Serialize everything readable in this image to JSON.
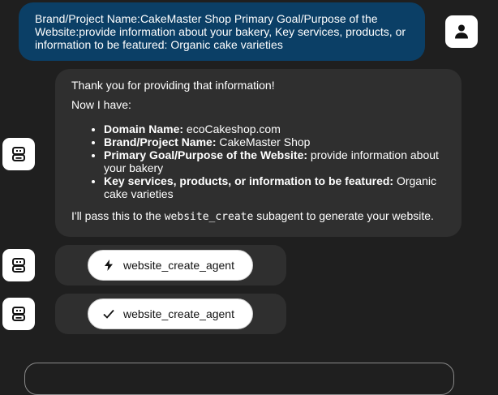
{
  "user_message": {
    "text": "Brand/Project Name:CakeMaster Shop Primary Goal/Purpose of the Website:provide information about your bakery, Key services, products, or information to be featured: Organic cake varieties"
  },
  "assistant_message": {
    "intro": "Thank you for providing that information!",
    "now_i_have": "Now I have:",
    "items": [
      {
        "label": "Domain Name:",
        "value": " ecoCakeshop.com"
      },
      {
        "label": "Brand/Project Name:",
        "value": " CakeMaster Shop"
      },
      {
        "label": "Primary Goal/Purpose of the Website:",
        "value": " provide information about your bakery"
      },
      {
        "label": "Key services, products, or information to be featured:",
        "value": " Organic cake varieties"
      }
    ],
    "outro_before": "I'll pass this to the ",
    "outro_code": "website_create",
    "outro_after": " subagent to generate your website."
  },
  "tool_calls": [
    {
      "label": "website_create_agent",
      "status": "running",
      "icon": "lightning-icon"
    },
    {
      "label": "website_create_agent",
      "status": "completed",
      "icon": "checkmark-icon"
    }
  ],
  "icons": {
    "user_avatar": "person-icon",
    "assistant_avatar": "robot-icon"
  },
  "colors": {
    "background": "#1f1f1f",
    "user_bubble": "#0b3f66",
    "assistant_bubble": "#2f2f2f",
    "pill": "#ffffff"
  }
}
